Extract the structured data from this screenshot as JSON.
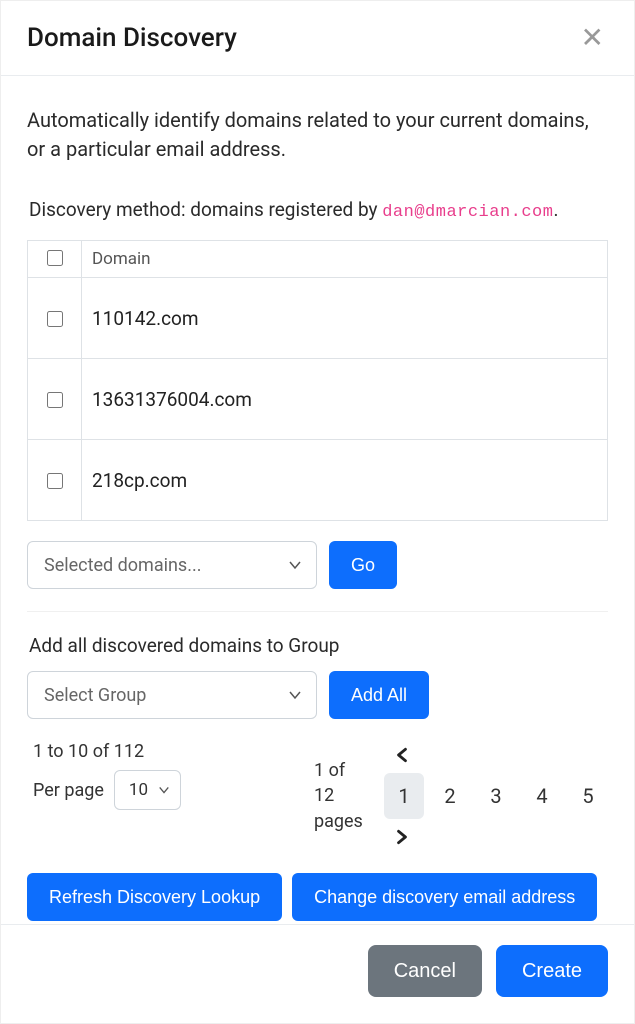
{
  "header": {
    "title": "Domain Discovery"
  },
  "lead": "Automatically identify domains related to your current domains, or a particular email address.",
  "method": {
    "prefix": "Discovery method: domains registered by ",
    "email": "dan@dmarcian.com",
    "suffix": "."
  },
  "table": {
    "header_domain": "Domain",
    "rows": [
      {
        "domain": "110142.com"
      },
      {
        "domain": "13631376004.com"
      },
      {
        "domain": "218cp.com"
      }
    ]
  },
  "selected_action": {
    "placeholder": "Selected domains...",
    "go_label": "Go"
  },
  "group_section": {
    "label": "Add all discovered domains to Group",
    "select_placeholder": "Select Group",
    "add_all_label": "Add All"
  },
  "pagination": {
    "range_text": "1 to 10 of 112",
    "per_page_label": "Per page",
    "per_page_value": "10",
    "page_info_line1": "1 of",
    "page_info_line2": "12",
    "page_info_line3": "pages",
    "pages": [
      "1",
      "2",
      "3",
      "4",
      "5"
    ],
    "active_page": "1"
  },
  "lookup_buttons": {
    "refresh": "Refresh Discovery Lookup",
    "change_email": "Change discovery email address"
  },
  "footer": {
    "cancel": "Cancel",
    "create": "Create"
  }
}
